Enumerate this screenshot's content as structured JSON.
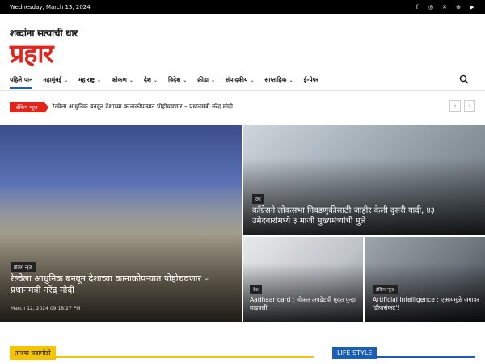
{
  "topbar": {
    "date": "Wednesday, March 13, 2024",
    "social_icons": [
      "facebook-icon",
      "instagram-icon",
      "x-twitter-icon",
      "globe-icon",
      "youtube-icon"
    ]
  },
  "logo": {
    "tagline": "शब्दांना सत्याची धार",
    "name": "प्रहार"
  },
  "nav": {
    "items": [
      {
        "label": "पहिले पान",
        "dropdown": false
      },
      {
        "label": "महामुंबई",
        "dropdown": true
      },
      {
        "label": "महाराष्ट्र",
        "dropdown": true
      },
      {
        "label": "कोकण",
        "dropdown": true
      },
      {
        "label": "देश",
        "dropdown": true
      },
      {
        "label": "विदेश",
        "dropdown": true
      },
      {
        "label": "क्रीडा",
        "dropdown": true
      },
      {
        "label": "संपादकीय",
        "dropdown": true
      },
      {
        "label": "साप्ताहिक",
        "dropdown": true
      },
      {
        "label": "ई-पेपर",
        "dropdown": false
      }
    ]
  },
  "ticker": {
    "badge": "ब्रेकिंग न्यूज",
    "headline": "रेल्वेला आधुनिक बनवून देशाच्या कानाकोपऱ्यात पोहोचवणार – प्रधानमंत्री नरेंद्र मोदी"
  },
  "features": {
    "main": {
      "category": "ब्रेकिंग न्यूज",
      "title": "रेल्वेला आधुनिक बनवून देशाच्या कानाकोपऱ्यात पोहोचवणार – प्रधानमंत्री नरेंद्र मोदी",
      "date": "March 12, 2024 09:18:27 PM"
    },
    "top_right": {
      "category": "देश",
      "title": "काँग्रेसने लोकसभा निवडणुकीसाठी जाहीर केली दुसरी यादी, ४३ उमेदवारांमध्ये ३ माजी मुख्यमंत्र्यांची मुले"
    },
    "bottom_left": {
      "category": "देश",
      "title": "Aadhaar card : मोफत अपडेटची मुदत पुन्हा वाढवली"
    },
    "bottom_right": {
      "category": "ब्रेकिंग न्यूज",
      "title": "Artificial Intelligence : एआयमुळे जगावर 'डीजसंकट'!"
    }
  },
  "sections": {
    "left": "ताज्या घडामोडी",
    "right": "LIFE STYLE"
  },
  "colors": {
    "brand_red": "#e2241b",
    "accent_blue": "#1a5fb4",
    "accent_yellow": "#f5c400"
  }
}
